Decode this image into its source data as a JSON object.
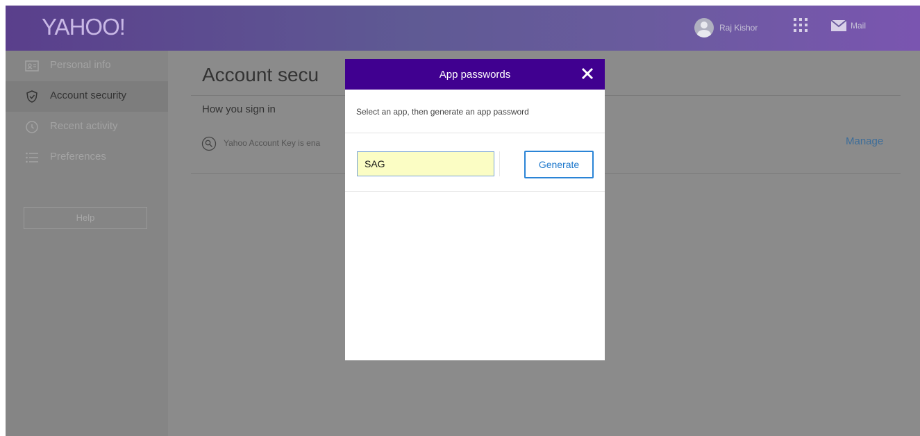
{
  "header": {
    "logo_text": "YAHOO!",
    "user_name": "Raj Kishor",
    "mail_label": "Mail"
  },
  "sidebar": {
    "items": [
      {
        "label": "Personal info",
        "icon": "id-card-icon",
        "active": false
      },
      {
        "label": "Account security",
        "icon": "shield-icon",
        "active": true
      },
      {
        "label": "Recent activity",
        "icon": "clock-icon",
        "active": false
      },
      {
        "label": "Preferences",
        "icon": "list-icon",
        "active": false
      }
    ],
    "help_label": "Help"
  },
  "main": {
    "title": "Account secu",
    "section_title": "How you sign in",
    "account_key_text": "Yahoo Account Key is ena",
    "manage_label": "Manage"
  },
  "modal": {
    "title": "App passwords",
    "close_icon": "close-icon",
    "description": "Select an app, then generate an app password",
    "app_input_value": "SAG",
    "generate_label": "Generate"
  },
  "colors": {
    "modal_header": "#400090",
    "generate_border": "#2a84d6",
    "input_background": "#fbfdc4",
    "manage_link": "#3d6d99"
  }
}
